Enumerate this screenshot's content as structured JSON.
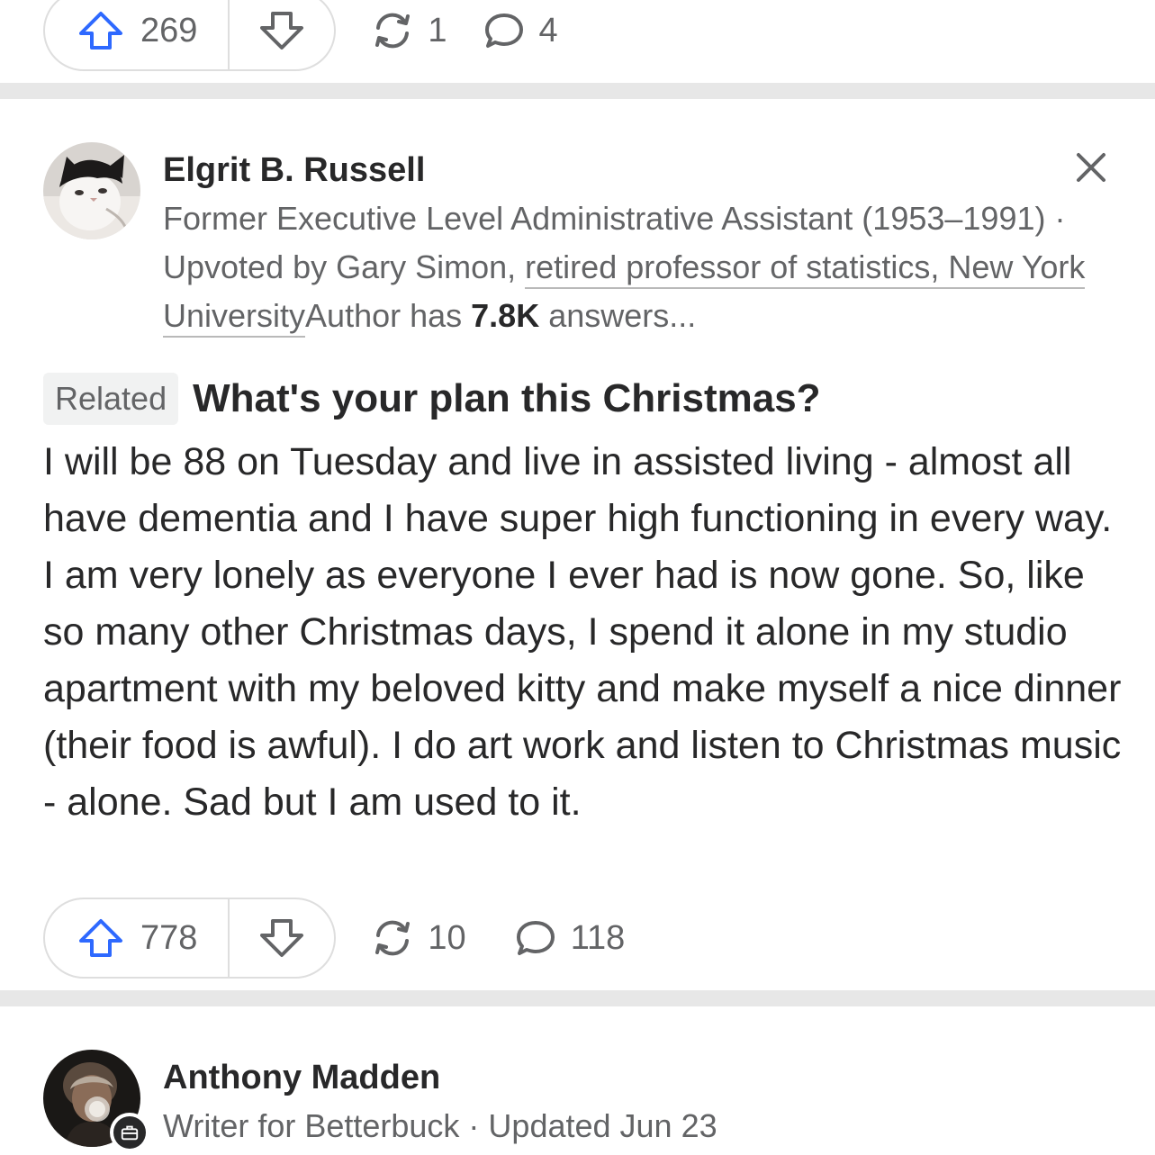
{
  "top_actions": {
    "upvotes": "269",
    "shares": "1",
    "comments": "4"
  },
  "answer": {
    "author_name": "Elgrit B. Russell",
    "credential_part1": "Former Executive Level Administrative Assistant (1953–1991) · Upvoted by Gary Simon, ",
    "credential_link": "retired professor of statistics, New York University",
    "credential_part2": "Author has ",
    "answer_count": "7.8K",
    "credential_part3": " answers...",
    "related_label": "Related",
    "question": "What's your plan this Christmas?",
    "body": "I will be 88 on Tuesday and live in assisted living - almost all have dementia and I have super high functioning in every way. I am very lonely as everyone I ever had is now gone. So, like so many other Christmas days, I spend it alone in my studio apartment with my beloved kitty and make myself a nice dinner (their food is awful). I do art work and listen to Christmas music - alone. Sad but I am used to it.",
    "upvotes": "778",
    "shares": "10",
    "comments": "118"
  },
  "next_answer": {
    "author_name": "Anthony Madden",
    "credential": "Writer for Betterbuck · Updated Jun 23"
  },
  "colors": {
    "upvote_blue": "#2e69ff",
    "icon_gray": "#636466",
    "divider": "#e7e7e7"
  },
  "icons": [
    "upvote-arrow-icon",
    "downvote-arrow-icon",
    "share-icon",
    "comment-icon",
    "close-icon",
    "briefcase-icon"
  ]
}
